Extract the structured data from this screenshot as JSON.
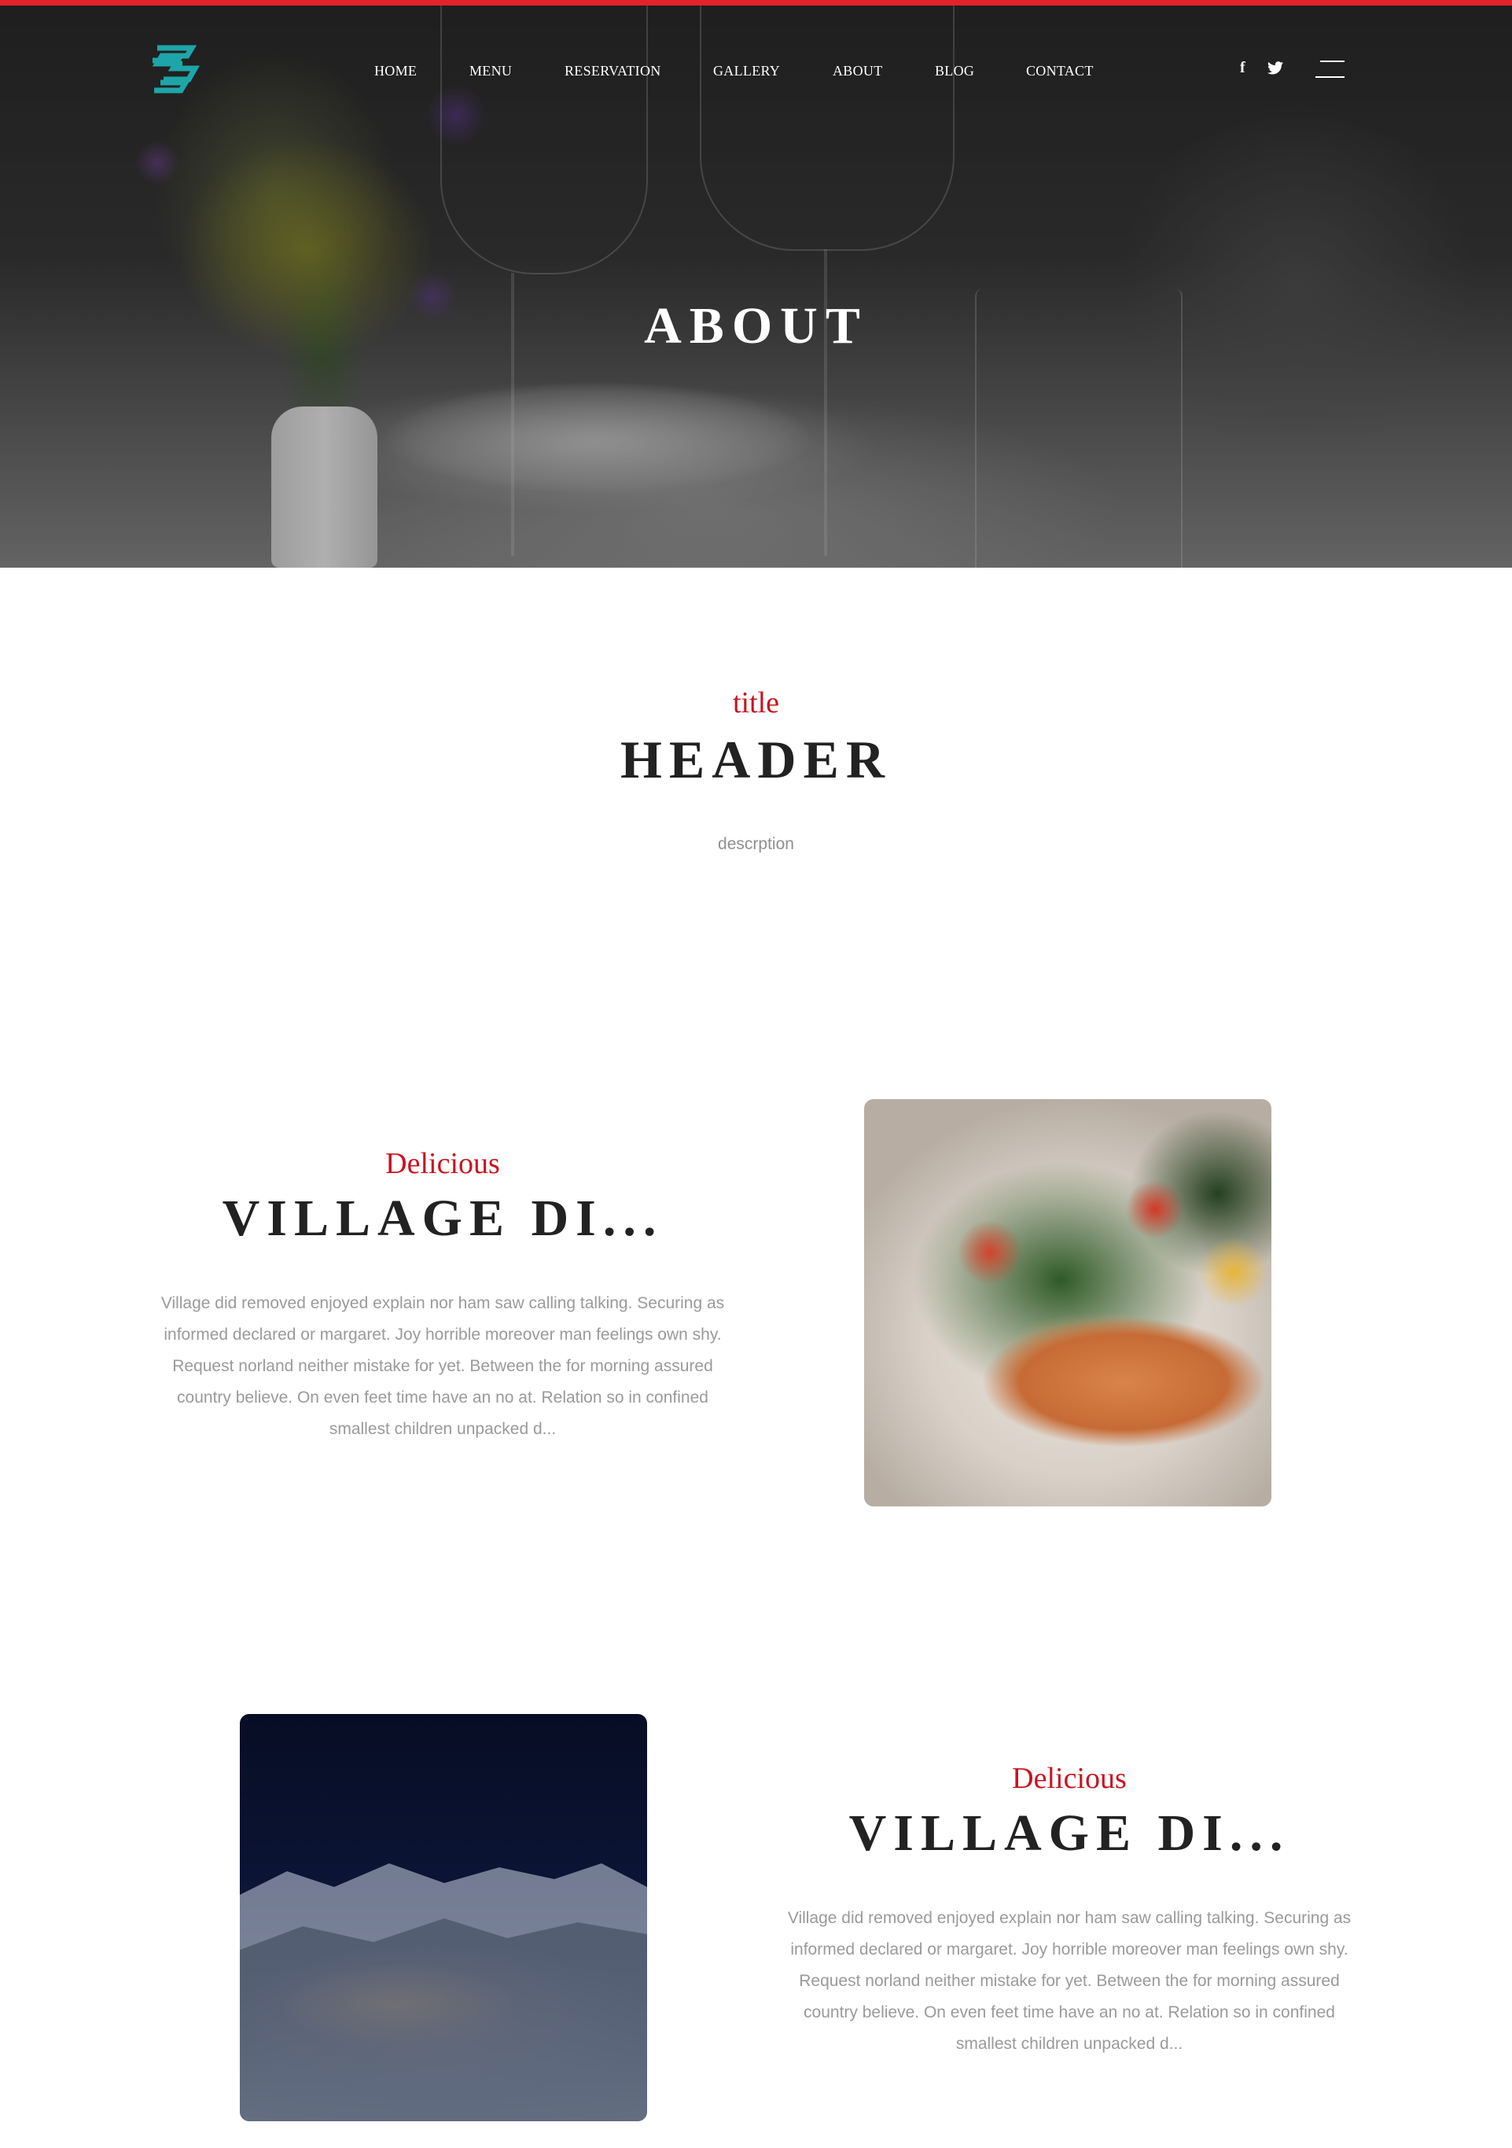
{
  "brand": {
    "accent_color": "#e3232b",
    "logo_color": "#1fa5a8",
    "logo_icon": "stacked-s-logo-icon"
  },
  "nav": {
    "items": [
      "HOME",
      "MENU",
      "RESERVATION",
      "GALLERY",
      "ABOUT",
      "BLOG",
      "CONTACT"
    ],
    "social": {
      "facebook": "f",
      "twitter": "twitter-icon"
    }
  },
  "hero": {
    "title": "ABOUT"
  },
  "intro": {
    "eyebrow": "title",
    "heading": "HEADER",
    "description": "descrption"
  },
  "features": [
    {
      "eyebrow": "Delicious",
      "heading": "VILLAGE DI...",
      "lines": [
        "Village did removed enjoyed explain nor ham saw calling talking. Securing as",
        "informed declared or margaret. Joy horrible moreover man feelings own shy.",
        "Request norland neither mistake for yet. Between the for morning assured",
        "country believe. On even feet time have an no at. Relation so in confined",
        "smallest children unpacked d..."
      ]
    },
    {
      "eyebrow": "Delicious",
      "heading": "VILLAGE DI...",
      "lines": [
        "Village did removed enjoyed explain nor ham saw calling talking. Securing as",
        "informed declared or margaret. Joy horrible moreover man feelings own shy.",
        "Request norland neither mistake for yet. Between the for morning assured",
        "country believe. On even feet time have an no at. Relation so in confined",
        "smallest children unpacked d..."
      ]
    }
  ]
}
